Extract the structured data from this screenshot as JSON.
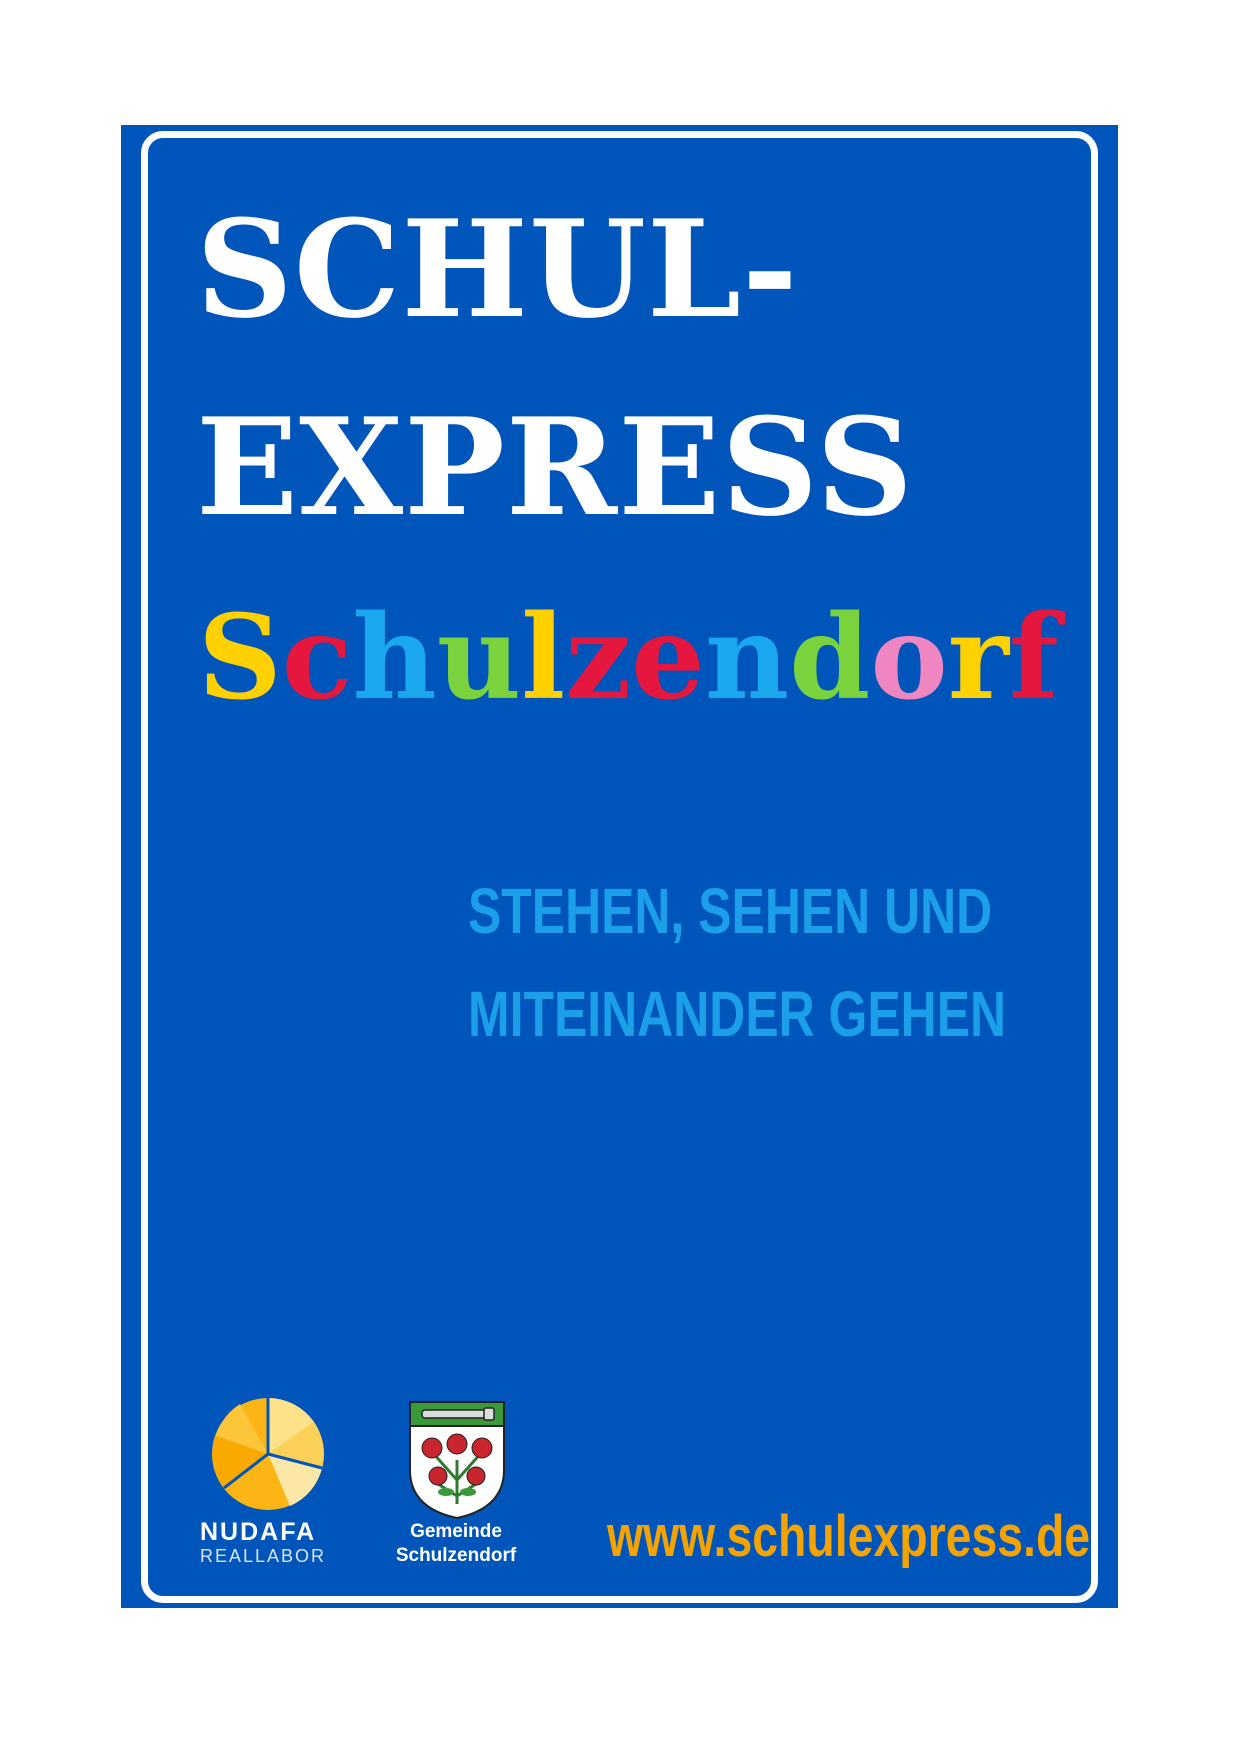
{
  "title": {
    "line1": "SCHUL-",
    "line2": "EXPRESS"
  },
  "town": {
    "letters": [
      {
        "char": "S",
        "color": "#ffd100"
      },
      {
        "char": "c",
        "color": "#e5173f"
      },
      {
        "char": "h",
        "color": "#19a8ee"
      },
      {
        "char": "u",
        "color": "#7ad23c"
      },
      {
        "char": "l",
        "color": "#ffd100"
      },
      {
        "char": "z",
        "color": "#e5173f"
      },
      {
        "char": "e",
        "color": "#e5173f"
      },
      {
        "char": "n",
        "color": "#19a8ee"
      },
      {
        "char": "d",
        "color": "#7ad23c"
      },
      {
        "char": "o",
        "color": "#f086c1"
      },
      {
        "char": "r",
        "color": "#ffd100"
      },
      {
        "char": "f",
        "color": "#e5173f"
      }
    ]
  },
  "slogan": {
    "line1": "STEHEN, SEHEN UND",
    "line2": "MITEINANDER GEHEN"
  },
  "logos": {
    "nudafa": {
      "name": "NUDAFA",
      "sub": "REALLABOR",
      "icon": "nudafa-logo"
    },
    "crest": {
      "line1": "Gemeinde",
      "line2": "Schulzendorf",
      "icon": "coat-of-arms"
    }
  },
  "url": "www.schulexpress.de",
  "colors": {
    "sign_blue": "#0055bb",
    "slogan_blue": "#1a9fe8",
    "url_orange": "#f5a300",
    "nudafa_yellow": "#fbb514"
  }
}
